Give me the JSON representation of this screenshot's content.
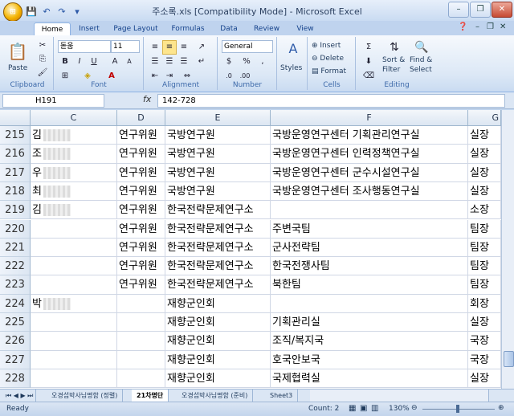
{
  "window": {
    "title": "주소록.xls  [Compatibility Mode] - Microsoft Excel",
    "office": "⊞"
  },
  "qat": [
    "💾",
    "↶",
    "↷",
    "▾"
  ],
  "ribbon_tabs": [
    "Home",
    "Insert",
    "Page Layout",
    "Formulas",
    "Data",
    "Review",
    "View"
  ],
  "ribbon": {
    "clipboard": {
      "label": "Clipboard",
      "paste": "Paste"
    },
    "font": {
      "label": "Font",
      "name": "돋움",
      "size": "11",
      "bold": "B",
      "italic": "I",
      "underline": "U",
      "grow": "A",
      "shrink": "A"
    },
    "alignment": {
      "label": "Alignment"
    },
    "number": {
      "label": "Number",
      "format": "General",
      "currency": "$",
      "percent": "%",
      "comma": ","
    },
    "styles": {
      "label": "Styles"
    },
    "cells": {
      "label": "Cells",
      "insert": "Insert",
      "delete": "Delete",
      "format": "Format"
    },
    "editing": {
      "label": "Editing",
      "sort": "Sort &",
      "filter": "Filter",
      "find": "Find &",
      "select": "Select",
      "sum": "Σ"
    }
  },
  "formula_bar": {
    "namebox": "H191",
    "fx": "fx",
    "value": "142-728"
  },
  "columns": [
    "C",
    "D",
    "E",
    "F",
    "G"
  ],
  "rows": [
    {
      "num": "215",
      "c": "김",
      "c_blur": true,
      "d": "연구위원",
      "e": "국방연구원",
      "f": "국방운영연구센터 기획관리연구실",
      "g": "실장"
    },
    {
      "num": "216",
      "c": "조",
      "c_blur": true,
      "d": "연구위원",
      "e": "국방연구원",
      "f": "국방운영연구센터 인력정책연구실",
      "g": "실장"
    },
    {
      "num": "217",
      "c": "우",
      "c_blur": true,
      "d": "연구위원",
      "e": "국방연구원",
      "f": "국방운영연구센터 군수시설연구실",
      "g": "실장"
    },
    {
      "num": "218",
      "c": "최",
      "c_blur": true,
      "d": "연구위원",
      "e": "국방연구원",
      "f": "국방운영연구센터 조사행동연구실",
      "g": "실장"
    },
    {
      "num": "219",
      "c": "김",
      "c_blur": true,
      "d": "연구위원",
      "e": "한국전략문제연구소",
      "f": "",
      "g": "소장"
    },
    {
      "num": "220",
      "c": "",
      "c_blur": false,
      "d": "연구위원",
      "e": "한국전략문제연구소",
      "f": "주변국팀",
      "g": "팀장"
    },
    {
      "num": "221",
      "c": "",
      "c_blur": false,
      "d": "연구위원",
      "e": "한국전략문제연구소",
      "f": "군사전략팀",
      "g": "팀장"
    },
    {
      "num": "222",
      "c": "",
      "c_blur": false,
      "d": "연구위원",
      "e": "한국전략문제연구소",
      "f": "한국전쟁사팀",
      "g": "팀장"
    },
    {
      "num": "223",
      "c": "",
      "c_blur": false,
      "d": "연구위원",
      "e": "한국전략문제연구소",
      "f": "북한팀",
      "g": "팀장"
    },
    {
      "num": "224",
      "c": "박",
      "c_blur": true,
      "d": "",
      "e": "재향군인회",
      "f": "",
      "g": "회장"
    },
    {
      "num": "225",
      "c": "",
      "c_blur": false,
      "d": "",
      "e": "재향군인회",
      "f": "기획관리실",
      "g": "실장"
    },
    {
      "num": "226",
      "c": "",
      "c_blur": false,
      "d": "",
      "e": "재향군인회",
      "f": "조직/복지국",
      "g": "국장"
    },
    {
      "num": "227",
      "c": "",
      "c_blur": false,
      "d": "",
      "e": "재향군인회",
      "f": "호국안보국",
      "g": "국장"
    },
    {
      "num": "228",
      "c": "",
      "c_blur": false,
      "d": "",
      "e": "재향군인회",
      "f": "국제협력실",
      "g": "실장"
    }
  ],
  "sheet_tabs": [
    "오경섭박사님명함 (정렬)",
    "21차명단",
    "오경섭박사님명함 (준비)",
    "Sheet3"
  ],
  "active_sheet_index": 1,
  "status": {
    "ready": "Ready",
    "count": "Count: 2",
    "zoom": "130%"
  }
}
